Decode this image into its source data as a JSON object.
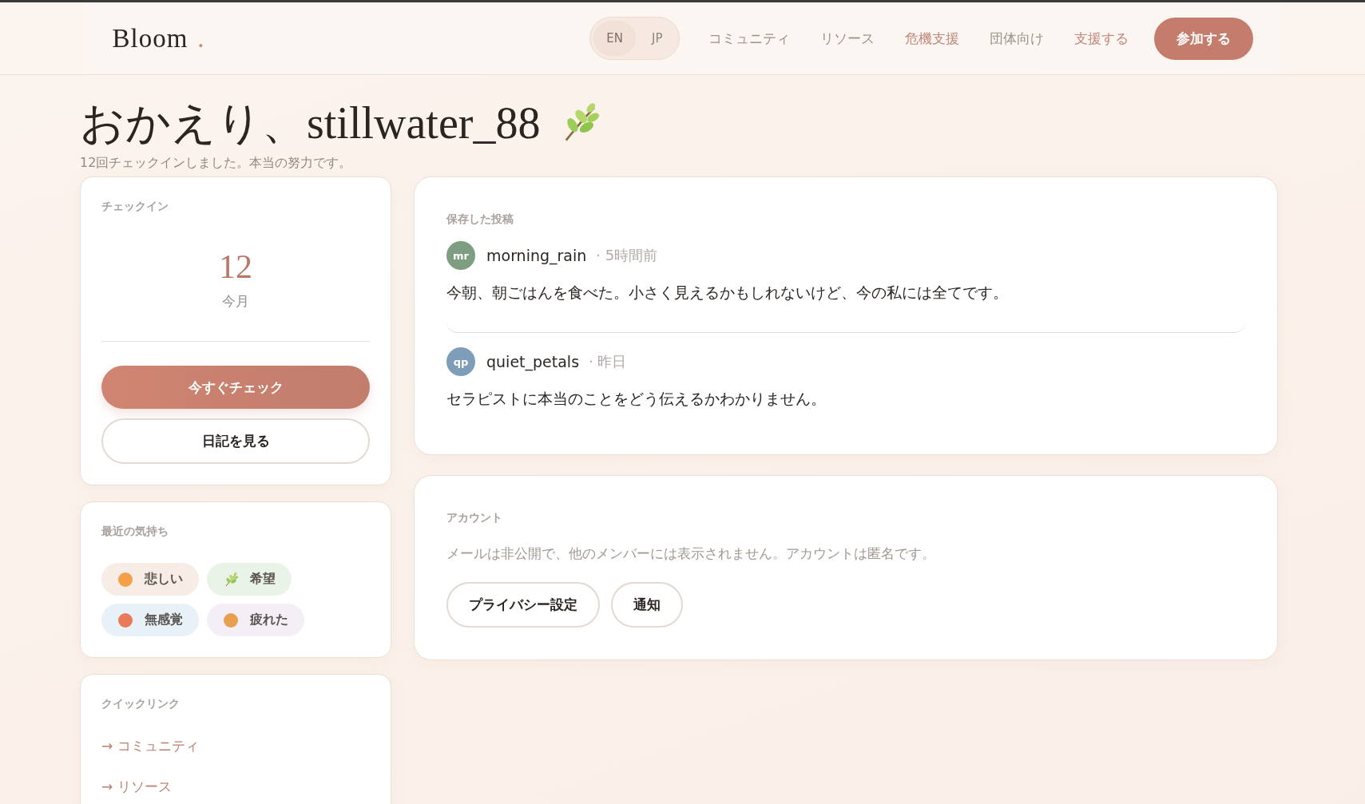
{
  "header": {
    "logo": "Bloom",
    "logo_mark": ".",
    "languages": [
      {
        "label": "EN",
        "selected": true
      },
      {
        "label": "JP",
        "selected": false
      }
    ],
    "nav": [
      {
        "label": "コミュニティ",
        "kind": "plain"
      },
      {
        "label": "リソース",
        "kind": "plain"
      },
      {
        "label": "危機支援",
        "kind": "accent"
      },
      {
        "label": "団体向け",
        "kind": "plain"
      },
      {
        "label": "支援する",
        "kind": "accent"
      }
    ],
    "join_button": "参加する"
  },
  "greeting": {
    "title": "おかえり、stillwater_88",
    "subtitle": "12回チェックインしました。本当の努力です。"
  },
  "checkin": {
    "heading": "チェックイン",
    "count": "12",
    "period": "今月",
    "primary_button": "今すぐチェック",
    "secondary_button": "日記を見る"
  },
  "moods": {
    "heading": "最近の気持ち",
    "items": [
      {
        "label": "悲しい",
        "kind": "face",
        "color": "#f8ece6"
      },
      {
        "label": "希望",
        "kind": "leaf",
        "color": "#eaf3e8"
      },
      {
        "label": "無感覚",
        "kind": "face",
        "color": "#e9f1f8"
      },
      {
        "label": "疲れた",
        "kind": "face",
        "color": "#f4eef6"
      }
    ]
  },
  "quick_links": {
    "heading": "クイックリンク",
    "items": [
      "→ コミュニティ",
      "→ リソース"
    ]
  },
  "saved_posts": {
    "heading": "保存した投稿",
    "posts": [
      {
        "initials": "mr",
        "author": "morning_rain",
        "time": "· 5時間前",
        "text": "今朝、朝ごはんを食べた。小さく見えるかもしれないけど、今の私には全てです。",
        "color": "#7d9e80"
      },
      {
        "initials": "qp",
        "author": "quiet_petals",
        "time": "· 昨日",
        "text": "セラピストに本当のことをどう伝えるかわかりません。",
        "color": "#7d9db8"
      }
    ]
  },
  "account": {
    "heading": "アカウント",
    "note": "メールは非公開で、他のメンバーには表示されません。アカウントは匿名です。",
    "buttons": [
      "プライバシー設定",
      "通知"
    ]
  }
}
